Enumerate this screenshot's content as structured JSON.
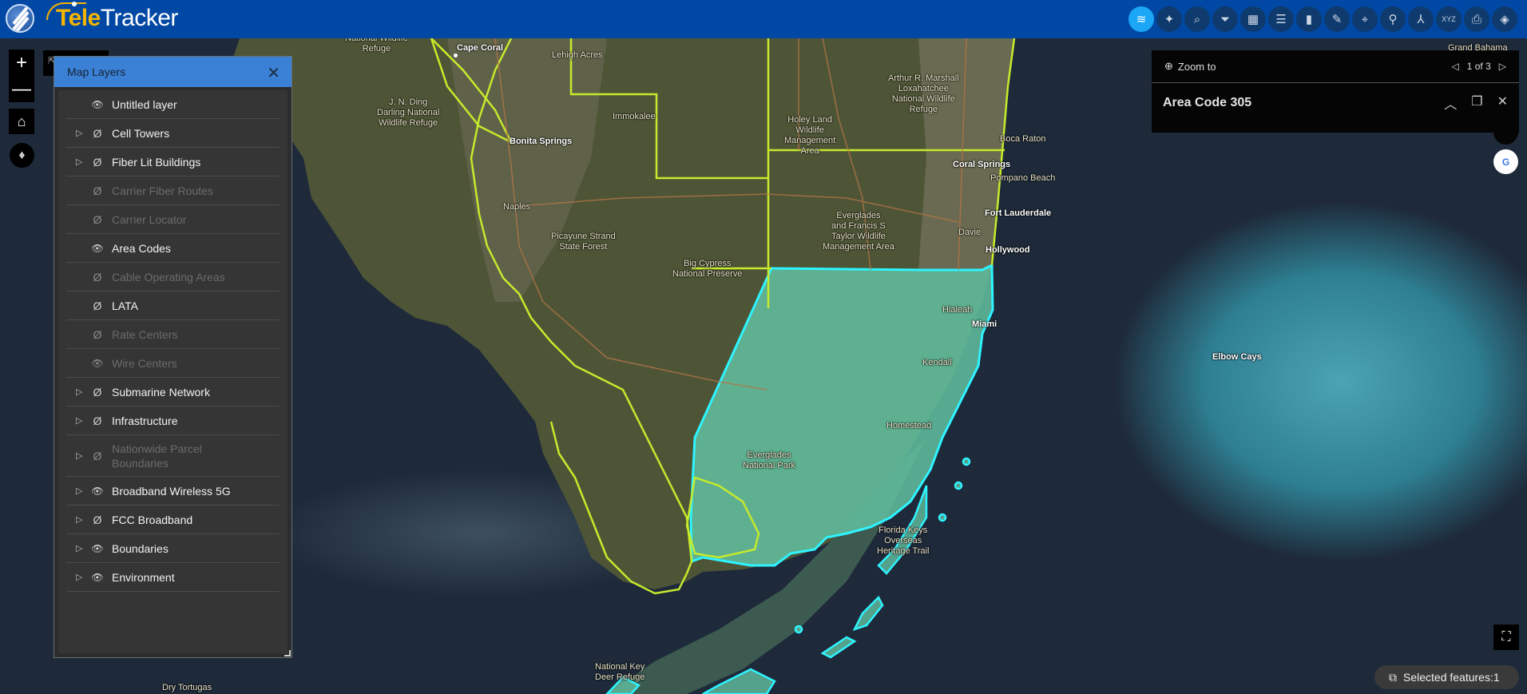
{
  "app": {
    "title_part1": "Tele",
    "title_part2": "Tracker"
  },
  "toolbar": {
    "tools": [
      {
        "name": "layers",
        "icon": "≋",
        "active": true
      },
      {
        "name": "ai-assistant",
        "icon": "✦",
        "active": false
      },
      {
        "name": "attribute-search",
        "icon": "⌕",
        "active": false
      },
      {
        "name": "filter",
        "icon": "⏷",
        "active": false
      },
      {
        "name": "table",
        "icon": "▦",
        "active": false
      },
      {
        "name": "legend-list",
        "icon": "☰",
        "active": false
      },
      {
        "name": "bookmark",
        "icon": "▮",
        "active": false
      },
      {
        "name": "basemap-palette",
        "icon": "✎",
        "active": false
      },
      {
        "name": "location-pin",
        "icon": "⌖",
        "active": false
      },
      {
        "name": "search-query",
        "icon": "⚲",
        "active": false
      },
      {
        "name": "coordinates-axes",
        "icon": "⅄",
        "active": false
      },
      {
        "name": "xyz-conversion",
        "icon": "XYZ",
        "active": false
      },
      {
        "name": "print",
        "icon": "⎙",
        "active": false
      },
      {
        "name": "directions",
        "icon": "◈",
        "active": false
      }
    ]
  },
  "map_controls": {
    "zoom_in": "+",
    "zoom_out": "—",
    "home": "⌂",
    "compass": "♦",
    "fullscreen": "⛶"
  },
  "layers_panel": {
    "title": "Map Layers",
    "close_icon": "✕",
    "layers": [
      {
        "label": "Untitled layer",
        "expandable": false,
        "visible": true,
        "dimmed": false
      },
      {
        "label": "Cell Towers",
        "expandable": true,
        "visible": false,
        "dimmed": false
      },
      {
        "label": "Fiber Lit Buildings",
        "expandable": true,
        "visible": false,
        "dimmed": false
      },
      {
        "label": "Carrier Fiber Routes",
        "expandable": false,
        "visible": false,
        "dimmed": true
      },
      {
        "label": "Carrier Locator",
        "expandable": false,
        "visible": false,
        "dimmed": true
      },
      {
        "label": "Area Codes",
        "expandable": false,
        "visible": true,
        "dimmed": false
      },
      {
        "label": "Cable Operating Areas",
        "expandable": false,
        "visible": false,
        "dimmed": true
      },
      {
        "label": "LATA",
        "expandable": false,
        "visible": false,
        "dimmed": false
      },
      {
        "label": "Rate Centers",
        "expandable": false,
        "visible": false,
        "dimmed": true
      },
      {
        "label": "Wire Centers",
        "expandable": false,
        "visible": true,
        "dimmed": true
      },
      {
        "label": "Submarine Network",
        "expandable": true,
        "visible": false,
        "dimmed": false
      },
      {
        "label": "Infrastructure",
        "expandable": true,
        "visible": false,
        "dimmed": false
      },
      {
        "label": "Nationwide Parcel Boundaries",
        "expandable": true,
        "visible": false,
        "dimmed": true
      },
      {
        "label": "Broadband Wireless 5G",
        "expandable": true,
        "visible": true,
        "dimmed": false
      },
      {
        "label": "FCC Broadband",
        "expandable": true,
        "visible": false,
        "dimmed": false
      },
      {
        "label": "Boundaries",
        "expandable": true,
        "visible": true,
        "dimmed": false
      },
      {
        "label": "Environment",
        "expandable": true,
        "visible": true,
        "dimmed": false
      }
    ]
  },
  "popup": {
    "zoom_to_label": "Zoom to",
    "pager_text": "1 of 3",
    "title": "Area Code 305"
  },
  "google_button_label": "G",
  "selected_features": {
    "label": "Selected features:1"
  },
  "map_labels": {
    "national_wildlife_refuge": "National Wildlife\nRefuge",
    "cape_coral": "Cape Coral",
    "lehigh_acres": "Lehigh Acres",
    "jn_ding": "J. N. Ding\nDarling National\nWildlife Refuge",
    "immokalee": "Immokalee",
    "bonita_springs": "Bonita Springs",
    "naples": "Naples",
    "picayune": "Picayune Strand\nState Forest",
    "big_cypress": "Big Cypress\nNational Preserve",
    "arthur_marshall": "Arthur R. Marshall\nLoxahatchee\nNational Wildlife\nRefuge",
    "holey_land": "Holey Land\nWildlife\nManagement\nArea",
    "boca_raton": "Boca Raton",
    "coral_springs": "Coral Springs",
    "pompano_beach": "Pompano Beach",
    "fort_lauderdale": "Fort Lauderdale",
    "everglades_ft": "Everglades\nand Francis S\nTaylor Wildlife\nManagement Area",
    "davie": "Davie",
    "hollywood": "Hollywood",
    "hialeah": "Hialeah",
    "miami": "Miami",
    "kendall": "Kendall",
    "homestead": "Homestead",
    "everglades_np": "Everglades\nNational Park",
    "florida_keys": "Florida Keys\nOverseas\nHeritage Trail",
    "national_key_deer": "National Key\nDeer Refuge",
    "dry_tortugas": "Dry Tortugas",
    "elbow_cays": "Elbow Cays",
    "grand_bahama": "Grand Bahama"
  }
}
